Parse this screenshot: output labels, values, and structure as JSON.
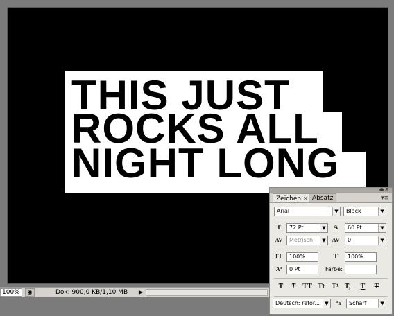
{
  "canvas": {
    "lines": [
      "THIS JUST",
      "ROCKS ALL",
      "NIGHT LONG"
    ]
  },
  "statusbar": {
    "zoom": "100%",
    "doc": "Dok: 900,0 KB/1,10 MB"
  },
  "panel": {
    "tabs": [
      "Zeichen",
      "Absatz"
    ],
    "font_family": "Arial",
    "font_style": "Black",
    "font_size": "72 Pt",
    "leading": "60 Pt",
    "kerning": "Metrisch",
    "tracking": "0",
    "vertical_scale": "100%",
    "horizontal_scale": "100%",
    "baseline_shift": "0 Pt",
    "color_label": "Farbe:",
    "language": "Deutsch: refor...",
    "antialias": "Scharf"
  },
  "icons": {
    "style_buttons": [
      "T",
      "T",
      "TT",
      "Tt",
      "T¹",
      "T,",
      "T",
      "T"
    ]
  }
}
